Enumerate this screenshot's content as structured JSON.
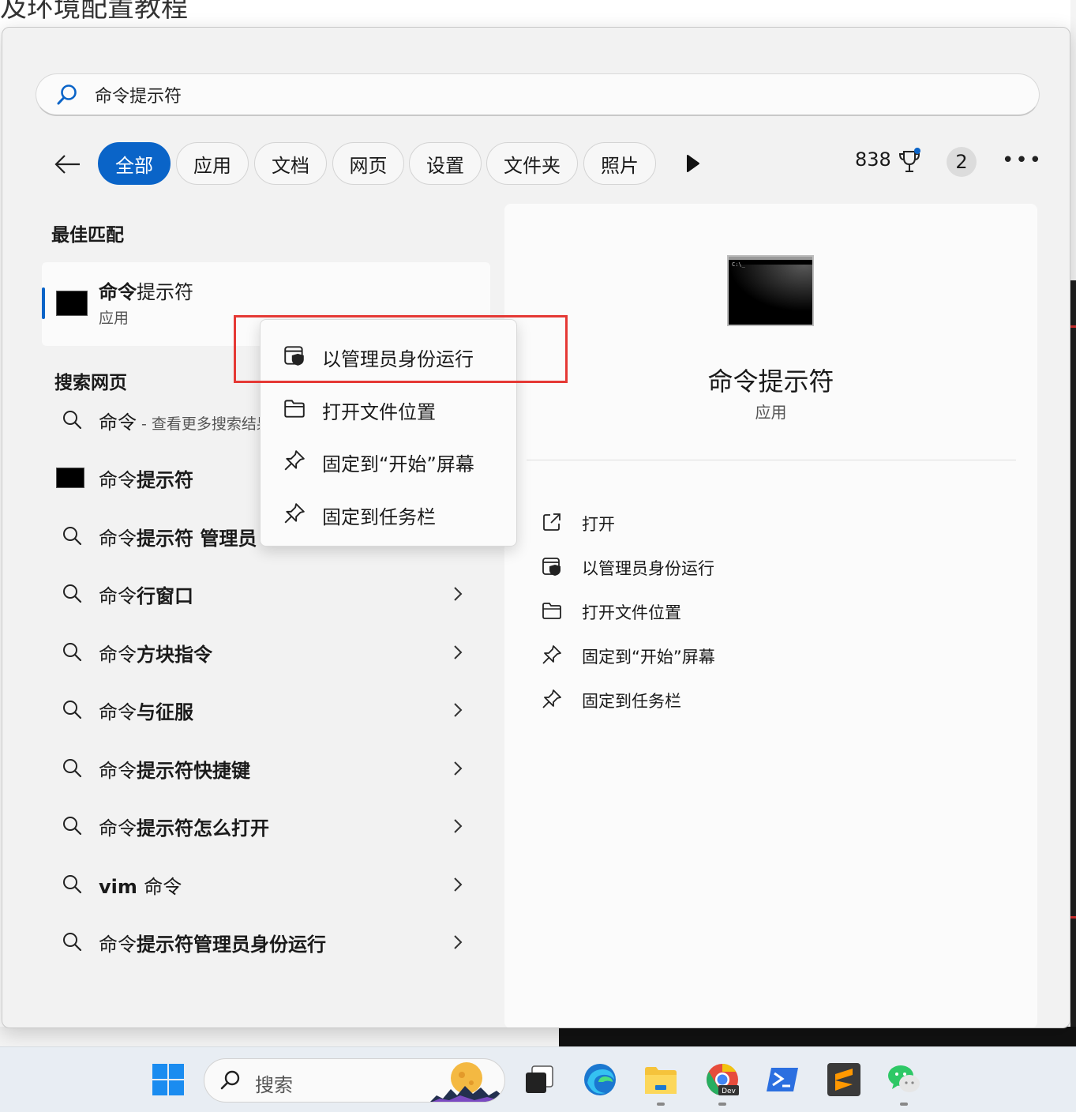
{
  "background": {
    "title_fragment": "及环境配置教程"
  },
  "search": {
    "query": "命令提示符",
    "placeholder": ""
  },
  "filters": {
    "tabs": [
      {
        "label": "全部",
        "active": true
      },
      {
        "label": "应用"
      },
      {
        "label": "文档"
      },
      {
        "label": "网页"
      },
      {
        "label": "设置"
      },
      {
        "label": "文件夹"
      },
      {
        "label": "照片"
      }
    ],
    "points": "838",
    "badge": "2"
  },
  "best_match": {
    "title": "最佳匹配",
    "name_bold": "命令",
    "name_rest": "提示符",
    "type": "应用"
  },
  "web": {
    "title": "搜索网页",
    "first": {
      "query": "命令",
      "suffix": " - 查看更多搜索结果"
    },
    "app_row": {
      "pre": "命令",
      "bold": "提示符"
    },
    "suggestions": [
      {
        "pre": "命令",
        "bold": "提示符 管理员"
      },
      {
        "pre": "命令",
        "bold": "行窗口"
      },
      {
        "pre": "命令",
        "bold": "方块指令"
      },
      {
        "pre": "命令",
        "bold": "与征服"
      },
      {
        "pre": "命令",
        "bold": "提示符快捷键"
      },
      {
        "pre": "命令",
        "bold": "提示符怎么打开"
      },
      {
        "pre": "命令",
        "bold": "vim ",
        "order": "bold-first"
      },
      {
        "pre": "命令",
        "bold": "提示符管理员身份运行"
      }
    ]
  },
  "detail": {
    "app_name": "命令提示符",
    "app_type": "应用",
    "icon_prompt": "C:\\_",
    "actions": [
      {
        "label": "打开",
        "icon": "open-external-icon"
      },
      {
        "label": "以管理员身份运行",
        "icon": "shield-icon"
      },
      {
        "label": "打开文件位置",
        "icon": "folder-icon"
      },
      {
        "label": "固定到“开始”屏幕",
        "icon": "pin-icon"
      },
      {
        "label": "固定到任务栏",
        "icon": "pin-icon"
      }
    ]
  },
  "context_menu": {
    "items": [
      {
        "label": "以管理员身份运行",
        "icon": "shield-icon"
      },
      {
        "label": "打开文件位置",
        "icon": "folder-icon"
      },
      {
        "label": "固定到“开始”屏幕",
        "icon": "pin-icon"
      },
      {
        "label": "固定到任务栏",
        "icon": "pin-icon"
      }
    ]
  },
  "taskbar": {
    "search_label": "搜索",
    "chrome_badge": "Dev",
    "accent": "#0a64c8",
    "highlight": "#e53935"
  }
}
